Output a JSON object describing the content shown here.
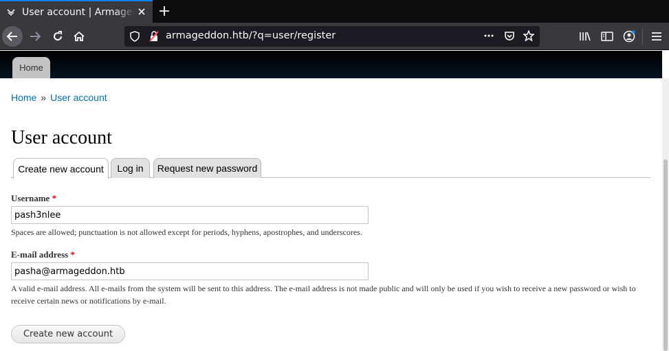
{
  "browser": {
    "tab_title": "User account | Armageddon",
    "url": "armageddon.htb/?q=user/register",
    "accent": "#0a84ff"
  },
  "site": {
    "nav_home": "Home"
  },
  "breadcrumb": {
    "home": "Home",
    "separator": "»",
    "current": "User account"
  },
  "page": {
    "title": "User account",
    "tabs": [
      {
        "label": "Create new account",
        "active": true
      },
      {
        "label": "Log in",
        "active": false
      },
      {
        "label": "Request new password",
        "active": false
      }
    ]
  },
  "form": {
    "username": {
      "label": "Username",
      "required_mark": "*",
      "value": "pash3nlee",
      "description": "Spaces are allowed; punctuation is not allowed except for periods, hyphens, apostrophes, and underscores."
    },
    "email": {
      "label": "E-mail address",
      "required_mark": "*",
      "value": "pasha@armageddon.htb",
      "description": "A valid e-mail address. All e-mails from the system will be sent to this address. The e-mail address is not made public and will only be used if you wish to receive a new password or wish to receive certain news or notifications by e-mail."
    },
    "submit_label": "Create new account"
  },
  "colors": {
    "link": "#0071b3",
    "required": "#cc0000"
  }
}
